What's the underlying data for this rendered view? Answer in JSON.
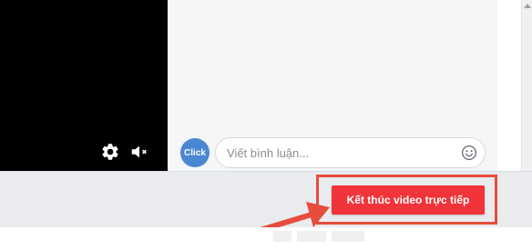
{
  "video": {
    "settings_icon": "gear-icon",
    "mute_icon": "speaker-muted-icon"
  },
  "comment_box": {
    "avatar_label": "Click",
    "placeholder": "Viết bình luận...",
    "emoji_icon": "smiley-icon",
    "avatar_color": "#4a86d1"
  },
  "actions": {
    "end_live_label": "Kết thúc video trực tiếp",
    "end_live_color": "#f0343a",
    "highlight_color": "#e74c3c"
  }
}
